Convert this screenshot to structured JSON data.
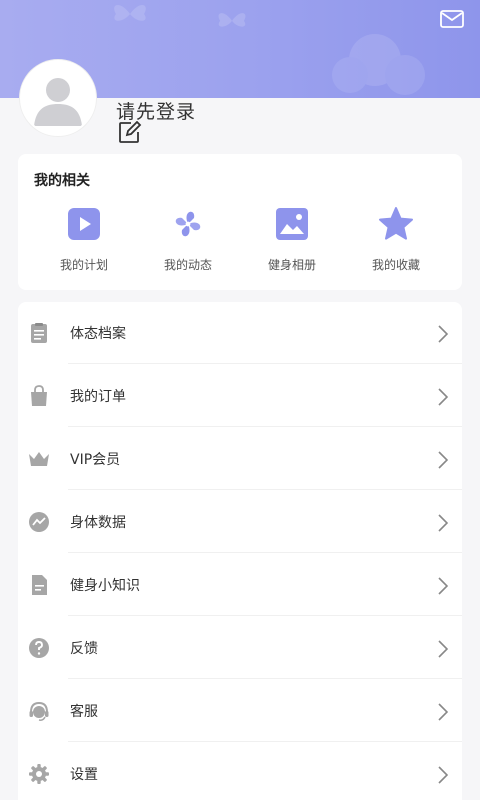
{
  "profile": {
    "login_prompt": "请先登录",
    "avatar_icon": "default-avatar-icon",
    "edit_icon": "edit-icon"
  },
  "header": {
    "mail_icon": "mail-icon",
    "accent_color": "#9ba1ee"
  },
  "mine": {
    "title": "我的相关",
    "items": [
      {
        "label": "我的计划",
        "icon": "play-icon"
      },
      {
        "label": "我的动态",
        "icon": "pinwheel-icon"
      },
      {
        "label": "健身相册",
        "icon": "image-icon"
      },
      {
        "label": "我的收藏",
        "icon": "star-icon"
      }
    ]
  },
  "menu": {
    "items": [
      {
        "label": "体态档案",
        "icon": "clipboard-icon"
      },
      {
        "label": "我的订单",
        "icon": "shopping-bag-icon"
      },
      {
        "label": "VIP会员",
        "icon": "crown-icon"
      },
      {
        "label": "身体数据",
        "icon": "trend-chart-icon"
      },
      {
        "label": "健身小知识",
        "icon": "document-icon"
      },
      {
        "label": "反馈",
        "icon": "question-icon"
      },
      {
        "label": "客服",
        "icon": "headset-icon"
      },
      {
        "label": "设置",
        "icon": "gear-icon"
      }
    ]
  }
}
